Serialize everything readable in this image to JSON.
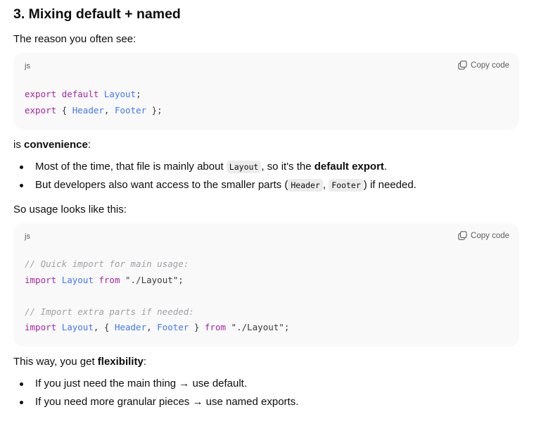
{
  "heading": "3. Mixing default + named",
  "intro": "The reason you often see:",
  "code_block_1": {
    "lang": "js",
    "copy_label": "Copy code",
    "line1": {
      "kw": "export",
      "kw2": "default",
      "id": "Layout",
      "end": ";"
    },
    "line2": {
      "kw": "export",
      "open": "{ ",
      "id1": "Header",
      "comma": ", ",
      "id2": "Footer",
      "close": " };"
    }
  },
  "convenience": {
    "pre": "is ",
    "bold": "convenience",
    "post": ":"
  },
  "bullets_1": [
    {
      "pre": "Most of the time, that file is mainly about ",
      "code": "Layout",
      "mid": ", so it's the ",
      "bold": "default export",
      "post": "."
    },
    {
      "pre": "But developers also want access to the smaller parts (",
      "code1": "Header",
      "sep": ", ",
      "code2": "Footer",
      "post": ") if needed."
    }
  ],
  "usage": "So usage looks like this:",
  "code_block_2": {
    "lang": "js",
    "copy_label": "Copy code",
    "comment1": "// Quick import for main usage:",
    "line1": {
      "kw": "import",
      "id": "Layout",
      "from": "from",
      "str": "\"./Layout\"",
      "end": ";"
    },
    "comment2": "// Import extra parts if needed:",
    "line2": {
      "kw": "import",
      "id1": "Layout",
      "mid": ", { ",
      "id2": "Header",
      "comma": ", ",
      "id3": "Footer",
      "close": " } ",
      "from": "from",
      "str": "\"./Layout\"",
      "end": ";"
    }
  },
  "flex": {
    "pre": "This way, you get ",
    "bold": "flexibility",
    "post": ":"
  },
  "bullets_2": [
    "If you just need the main thing → use default.",
    "If you need more granular pieces → use named exports."
  ]
}
